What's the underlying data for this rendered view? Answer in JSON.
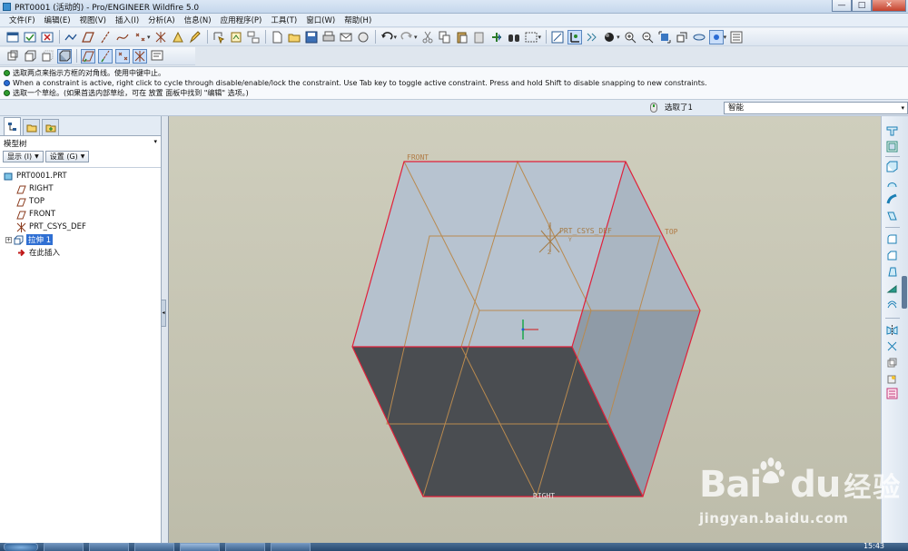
{
  "window": {
    "title": "PRT0001 (活动的) - Pro/ENGINEER Wildfire 5.0",
    "controls": [
      "—",
      "□",
      "✕"
    ]
  },
  "menubar": {
    "items": [
      "文件(F)",
      "编辑(E)",
      "视图(V)",
      "插入(I)",
      "分析(A)",
      "信息(N)",
      "应用程序(P)",
      "工具(T)",
      "窗口(W)",
      "帮助(H)"
    ]
  },
  "messages": [
    {
      "icon": "green-arrow-icon",
      "text": "选取两点来指示方框的对角线。使用中键中止。"
    },
    {
      "icon": "blue-info-icon",
      "text": "When a constraint is active, right click to cycle through disable/enable/lock the constraint. Use Tab key to toggle active constraint. Press and hold Shift to disable snapping to new constraints."
    },
    {
      "icon": "green-arrow-icon",
      "text": "选取一个草绘。(如果首选内部草绘，可在 放置 面板中找到 \"编辑\" 选项。)"
    }
  ],
  "selection": {
    "count_label": "选取了1",
    "filter_value": "智能"
  },
  "model_tree": {
    "header": "模型树",
    "show_button": "显示 (I)",
    "settings_button": "设置 (G)",
    "items": [
      {
        "label": "PRT0001.PRT",
        "icon": "part-icon"
      },
      {
        "label": "RIGHT",
        "icon": "datum-plane-icon"
      },
      {
        "label": "TOP",
        "icon": "datum-plane-icon"
      },
      {
        "label": "FRONT",
        "icon": "datum-plane-icon"
      },
      {
        "label": "PRT_CSYS_DEF",
        "icon": "csys-icon"
      },
      {
        "label": "拉伸 1",
        "icon": "extrude-icon",
        "selected": true
      },
      {
        "label": "在此插入",
        "icon": "insert-here-icon"
      }
    ]
  },
  "viewport": {
    "labels": {
      "front": "FRONT",
      "top": "TOP",
      "right": "RIGHT",
      "csys": "PRT_CSYS_DEF",
      "axis_x": "X",
      "axis_y": "Y",
      "axis_z": "Z"
    },
    "colors": {
      "background": "#c8c7b6",
      "top_face": "#b4c0cc",
      "side_face": "#8e9aa6",
      "bottom_face": "#4b4e52",
      "edges": "#e0203a",
      "datum": "#b98a4f"
    }
  },
  "taskbar": {
    "clock": "15:43"
  },
  "watermark": {
    "logo_left": "Bai",
    "logo_right": "du",
    "logo_cn": "经验",
    "url": "jingyan.baidu.com"
  }
}
